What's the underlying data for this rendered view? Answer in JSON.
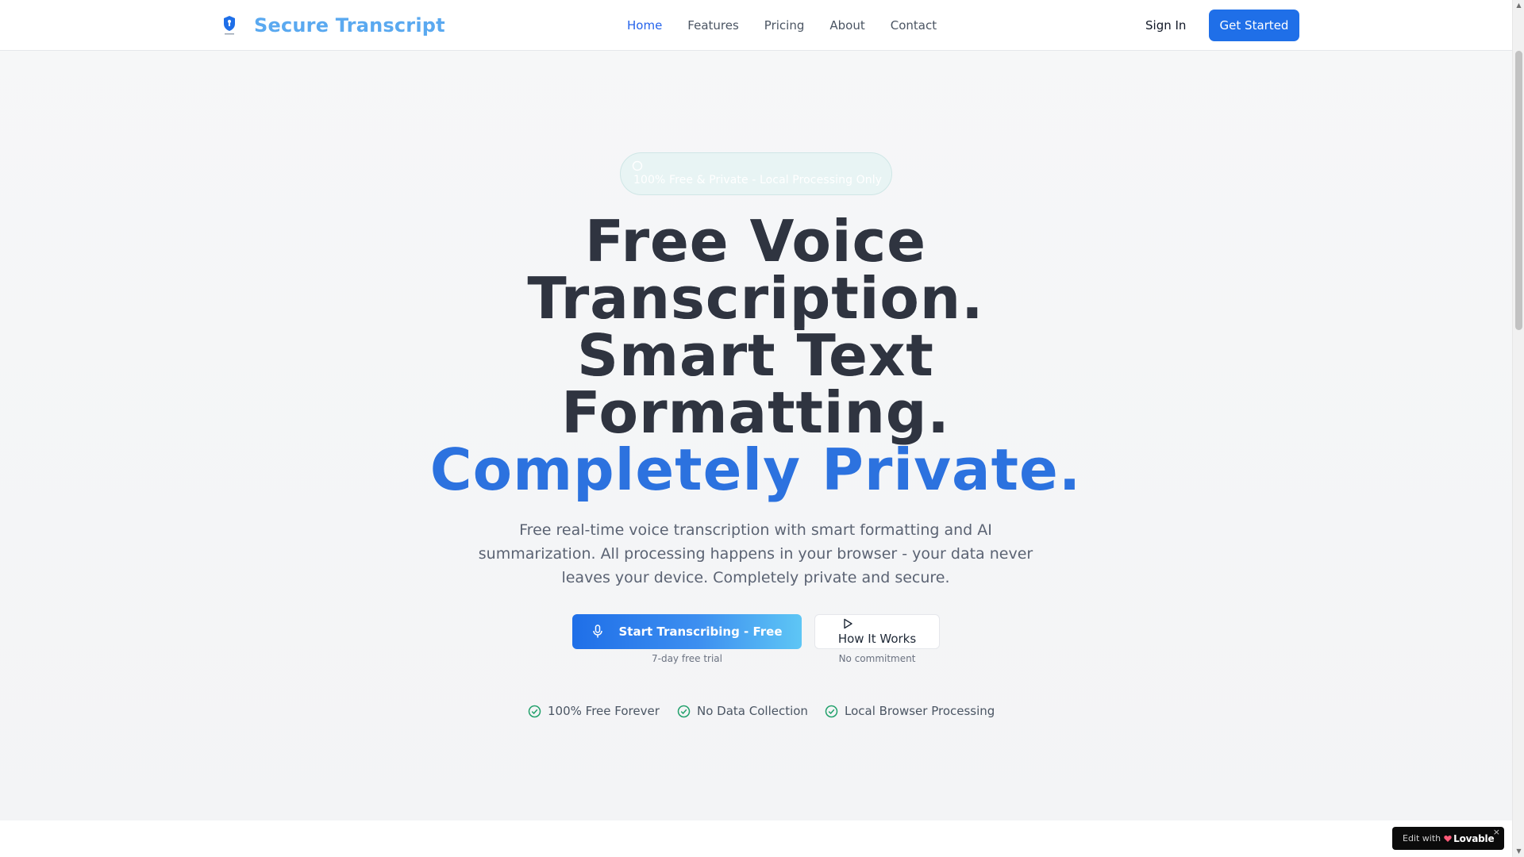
{
  "brand": {
    "name": "Secure Transcript",
    "icon": "shield-icon",
    "color": "#5aa9f0"
  },
  "nav": {
    "items": [
      {
        "label": "Home",
        "active": true
      },
      {
        "label": "Features",
        "active": false
      },
      {
        "label": "Pricing",
        "active": false
      },
      {
        "label": "About",
        "active": false
      },
      {
        "label": "Contact",
        "active": false
      }
    ],
    "sign_in": "Sign In",
    "get_started": "Get Started"
  },
  "hero": {
    "badge": {
      "icon": "circle-icon",
      "text": "100% Free & Private - Local Processing Only"
    },
    "headline": {
      "line1": "Free Voice",
      "line2": "Transcription.",
      "line3": "Smart Text",
      "line4": "Formatting.",
      "line5": "Completely Private."
    },
    "subtitle": "Free real-time voice transcription with smart formatting and AI summarization. All processing happens in your browser - your data never leaves your device. Completely private and secure.",
    "primary_button": {
      "label": "Start Transcribing - Free",
      "icon": "microphone-icon",
      "note": "7-day free trial"
    },
    "secondary_button": {
      "label": "How It Works",
      "icon": "play-icon",
      "note": "No commitment"
    },
    "features": [
      {
        "label": "100% Free Forever",
        "icon": "check-circle-icon"
      },
      {
        "label": "No Data Collection",
        "icon": "check-circle-icon"
      },
      {
        "label": "Local Browser Processing",
        "icon": "check-circle-icon"
      }
    ]
  },
  "badge_overlay": {
    "edit_label": "Edit with",
    "brand": "Lovable",
    "close": "×"
  },
  "colors": {
    "accent": "#1f6fe8",
    "headline_blue": "#2c72df",
    "check_green": "#22a06b"
  }
}
